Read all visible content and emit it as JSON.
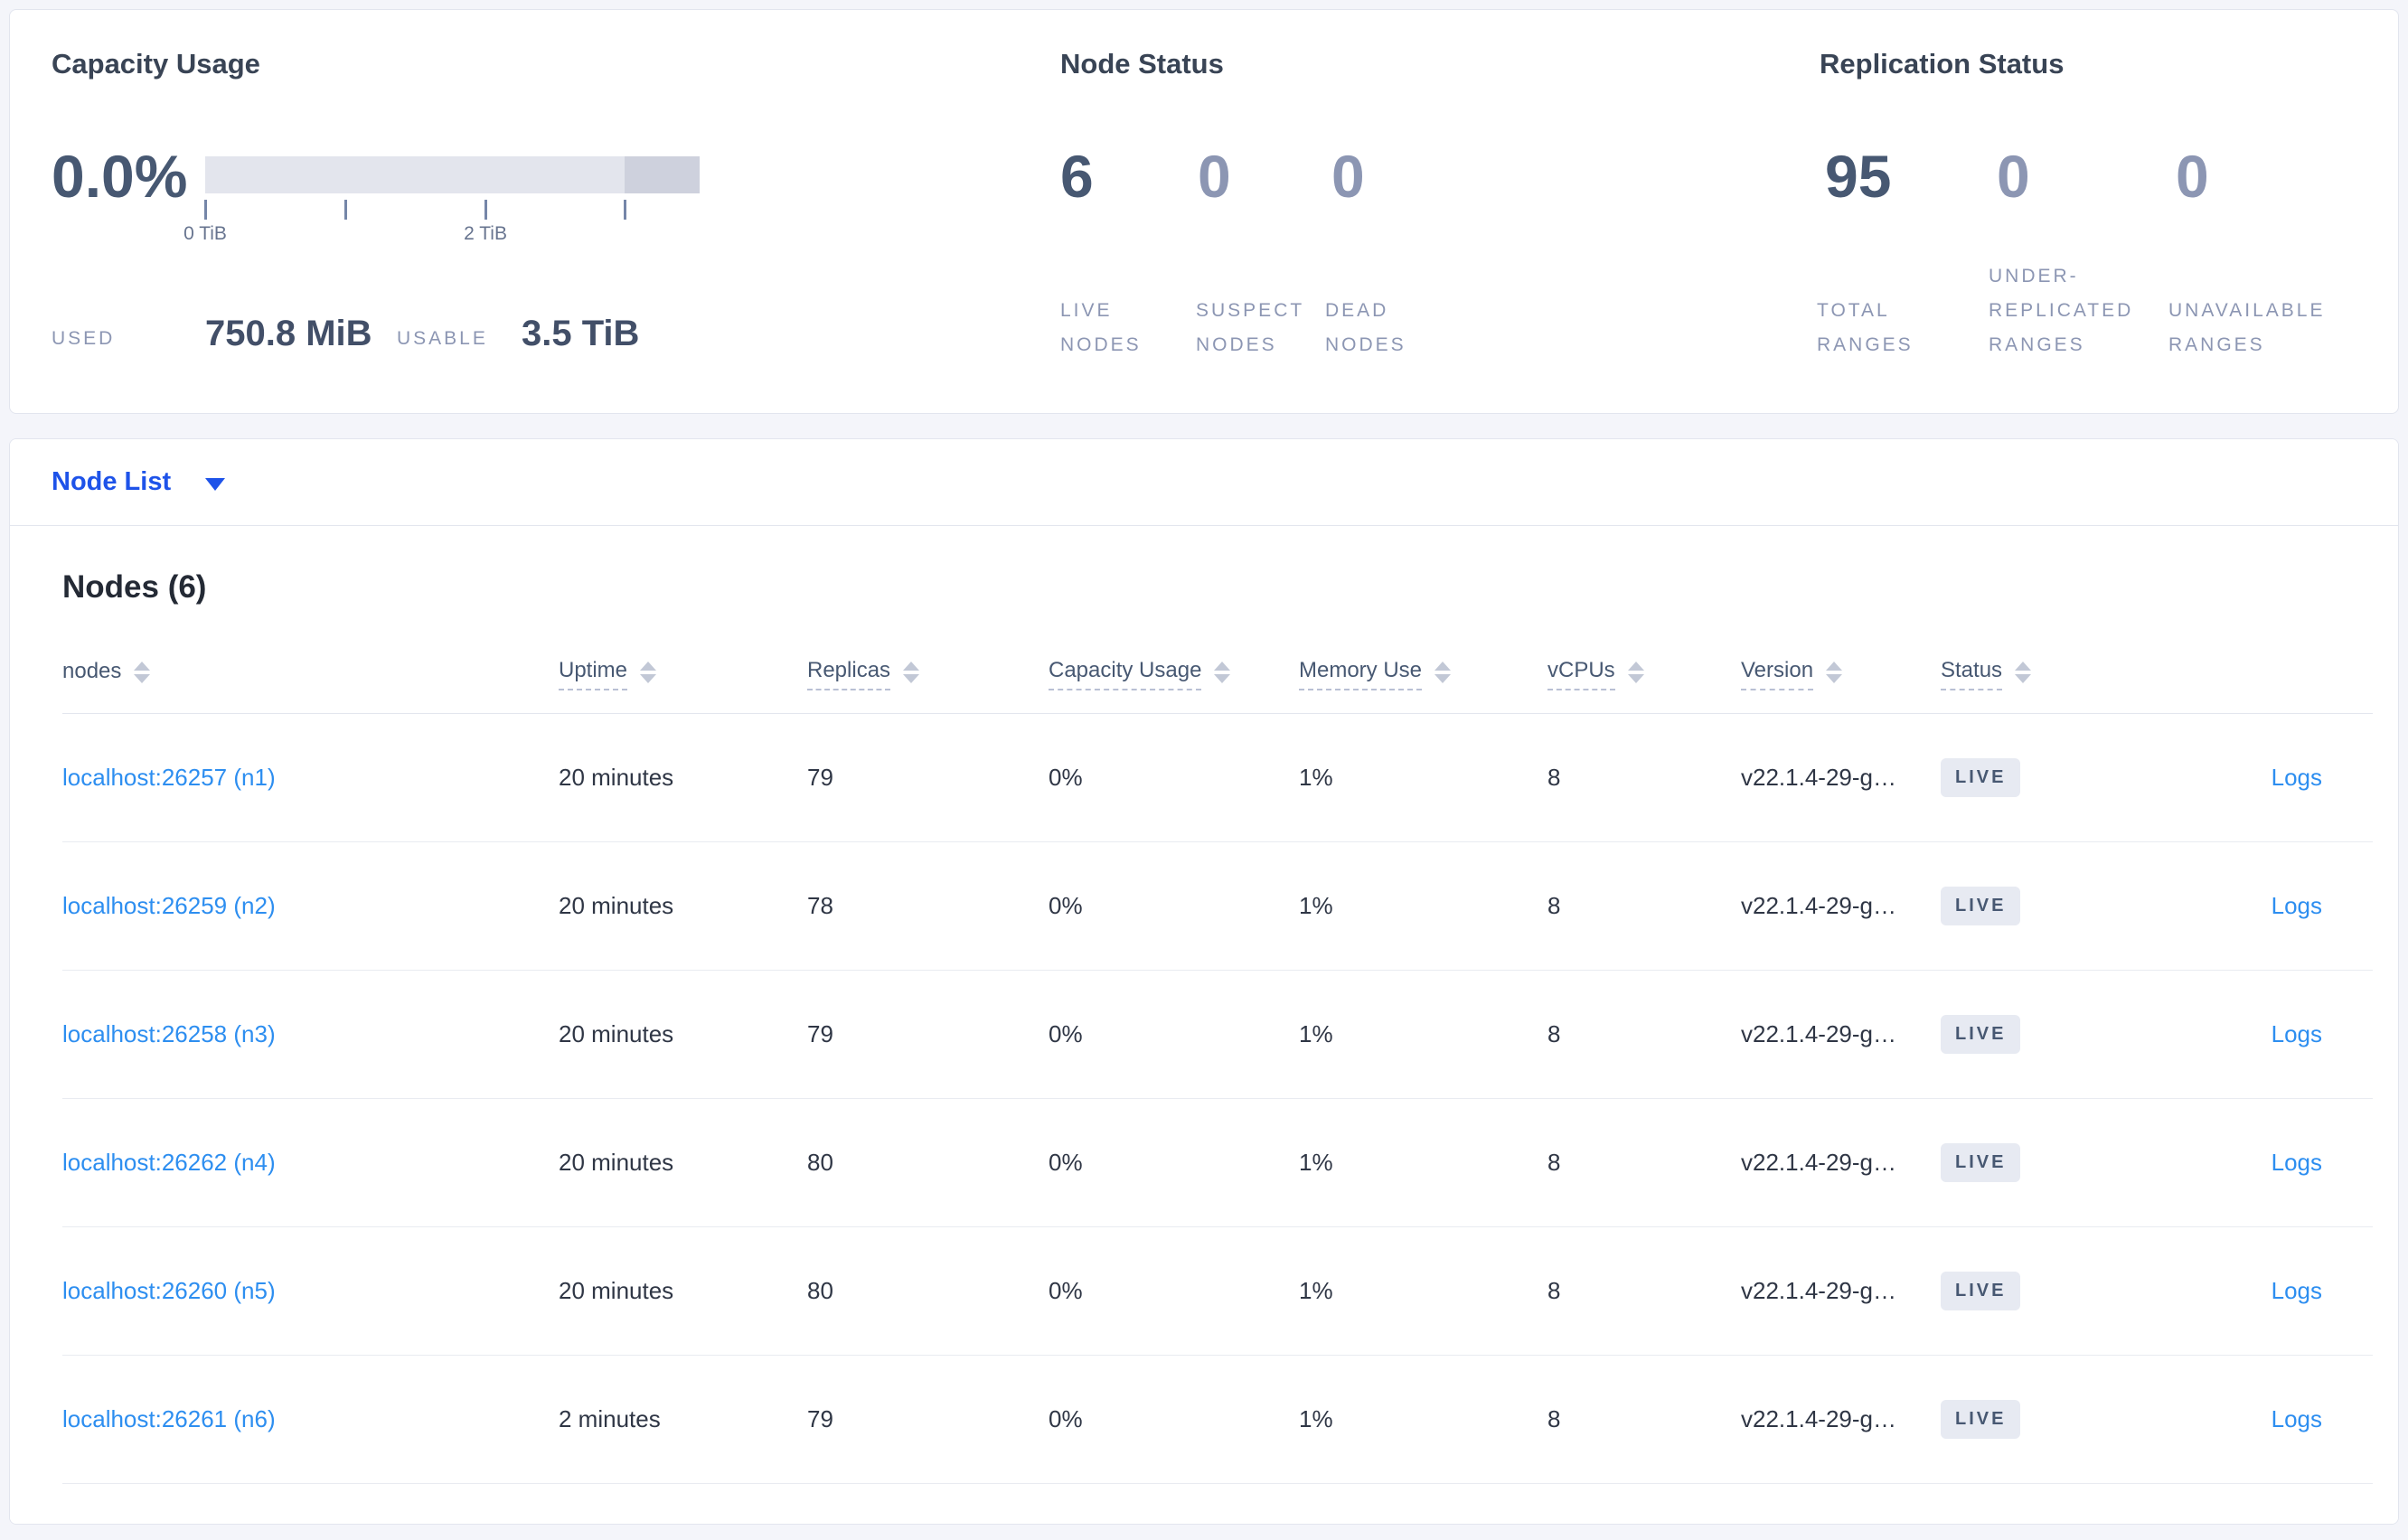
{
  "colors": {
    "page_bg": "#f4f5fa",
    "accent_link": "#1e53e9",
    "table_link": "#2d8ef0",
    "big_number": "#475872",
    "muted_number": "#8c96b3",
    "bar_light": "#e3e5ed",
    "bar_dark": "#ced1dd",
    "badge_bg": "#e7eaf2"
  },
  "capacity": {
    "title": "Capacity Usage",
    "percent": "0.0%",
    "bar": {
      "segments": [
        {
          "name": "usable",
          "color": "#e3e5ed",
          "fraction": 0.848
        },
        {
          "name": "other",
          "color": "#ced1dd",
          "fraction": 0.152
        }
      ],
      "ticks": [
        {
          "position": 0.0,
          "label": "0 TiB"
        },
        {
          "position": 0.2834,
          "label": ""
        },
        {
          "position": 0.5668,
          "label": "2 TiB"
        },
        {
          "position": 0.8483,
          "label": ""
        }
      ]
    },
    "used_label": "USED",
    "used_value": "750.8 MiB",
    "usable_label": "USABLE",
    "usable_value": "3.5 TiB"
  },
  "node_status": {
    "title": "Node Status",
    "stats": [
      {
        "value": "6",
        "label": "LIVE NODES"
      },
      {
        "value": "0",
        "label": "SUSPECT NODES"
      },
      {
        "value": "0",
        "label": "DEAD NODES"
      }
    ]
  },
  "replication": {
    "title": "Replication Status",
    "stats": [
      {
        "value": "95",
        "label": "TOTAL RANGES"
      },
      {
        "value": "0",
        "label": "UNDER-REPLICATED RANGES"
      },
      {
        "value": "0",
        "label": "UNAVAILABLE RANGES"
      }
    ]
  },
  "node_list": {
    "label": "Node List"
  },
  "table": {
    "title": "Nodes (6)",
    "columns": [
      {
        "label": "nodes",
        "sortable_underline": false
      },
      {
        "label": "Uptime",
        "sortable_underline": true
      },
      {
        "label": "Replicas",
        "sortable_underline": true
      },
      {
        "label": "Capacity Usage",
        "sortable_underline": true
      },
      {
        "label": "Memory Use",
        "sortable_underline": true
      },
      {
        "label": "vCPUs",
        "sortable_underline": true
      },
      {
        "label": "Version",
        "sortable_underline": true
      },
      {
        "label": "Status",
        "sortable_underline": true
      }
    ],
    "rows": [
      {
        "node": "localhost:26257 (n1)",
        "uptime": "20 minutes",
        "replicas": "79",
        "capacity": "0%",
        "memory": "1%",
        "vcpus": "8",
        "version": "v22.1.4-29-g…",
        "status": "LIVE",
        "logs": "Logs"
      },
      {
        "node": "localhost:26259 (n2)",
        "uptime": "20 minutes",
        "replicas": "78",
        "capacity": "0%",
        "memory": "1%",
        "vcpus": "8",
        "version": "v22.1.4-29-g…",
        "status": "LIVE",
        "logs": "Logs"
      },
      {
        "node": "localhost:26258 (n3)",
        "uptime": "20 minutes",
        "replicas": "79",
        "capacity": "0%",
        "memory": "1%",
        "vcpus": "8",
        "version": "v22.1.4-29-g…",
        "status": "LIVE",
        "logs": "Logs"
      },
      {
        "node": "localhost:26262 (n4)",
        "uptime": "20 minutes",
        "replicas": "80",
        "capacity": "0%",
        "memory": "1%",
        "vcpus": "8",
        "version": "v22.1.4-29-g…",
        "status": "LIVE",
        "logs": "Logs"
      },
      {
        "node": "localhost:26260 (n5)",
        "uptime": "20 minutes",
        "replicas": "80",
        "capacity": "0%",
        "memory": "1%",
        "vcpus": "8",
        "version": "v22.1.4-29-g…",
        "status": "LIVE",
        "logs": "Logs"
      },
      {
        "node": "localhost:26261 (n6)",
        "uptime": "2 minutes",
        "replicas": "79",
        "capacity": "0%",
        "memory": "1%",
        "vcpus": "8",
        "version": "v22.1.4-29-g…",
        "status": "LIVE",
        "logs": "Logs"
      }
    ]
  }
}
